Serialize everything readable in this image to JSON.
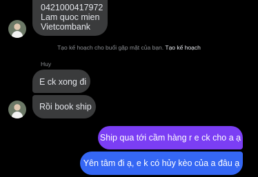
{
  "messages": {
    "incoming_top": {
      "lines": [
        "0421000417972",
        "Lam quoc mien",
        "Vietcombank"
      ]
    },
    "system_notice": {
      "text": "Tạo kế hoạch cho buổi gặp mặt của bạn.",
      "link": "Tạo kế hoạch"
    },
    "sender_name": "Huy",
    "incoming_1": "E ck xong đi",
    "incoming_2": "Rồi book ship",
    "outgoing_1": "Ship qua tới cầm hàng r e ck cho a ạ",
    "outgoing_2": "Yên tâm đi ạ, e k có hủy kèo của a đâu ạ"
  },
  "colors": {
    "incoming_bubble": "#3a3b3c",
    "outgoing_gradient_top": "#7b3ef4",
    "outgoing_gradient_bottom": "#3567f4"
  }
}
